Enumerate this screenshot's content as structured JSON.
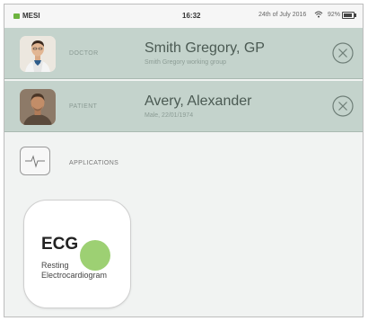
{
  "status": {
    "carrier": "MESI",
    "time": "16:32",
    "date": "24th of July 2016",
    "battery_pct": "92%",
    "battery_level": 0.92
  },
  "doctor": {
    "label": "DOCTOR",
    "name": "Smith Gregory, GP",
    "sub": "Smith Gregory working group"
  },
  "patient": {
    "label": "PATIENT",
    "name": "Avery, Alexander",
    "sub": "Male, 22/01/1974"
  },
  "applications": {
    "label": "APPLICATIONS"
  },
  "app_tiles": [
    {
      "title": "ECG",
      "subtitle_line1": "Resting",
      "subtitle_line2": "Electrocardiogram"
    }
  ],
  "colors": {
    "row_bg": "#c4d3cc",
    "brand_green": "#6db33f",
    "touch_indicator": "#8cc85a"
  }
}
